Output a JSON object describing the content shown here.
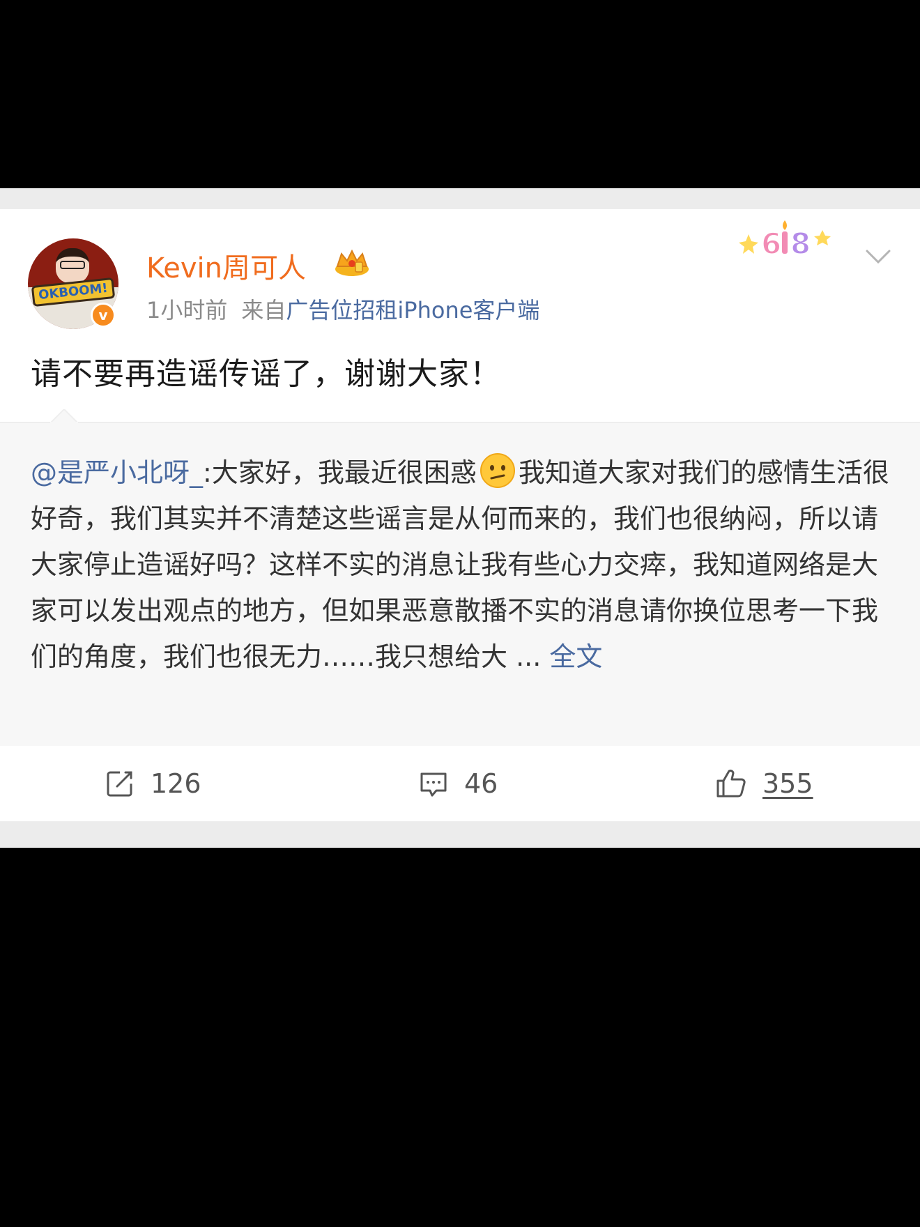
{
  "post": {
    "username": "Kevin周可人",
    "time": "1小时前",
    "source_prefix": "来自",
    "source": "广告位招租iPhone客户端",
    "verified_badge": "v",
    "text": "请不要再造谣传谣了，谢谢大家！"
  },
  "quoted": {
    "mention": "@是严小北呀_",
    "text_before_emoji": ":大家好，我最近很困惑",
    "text_after_emoji": "我知道大家对我们的感情生活很好奇，我们其实并不清楚这些谣言是从何而来的，我们也很纳闷，所以请大家停止造谣好吗？这样不实的消息让我有些心力交瘁，我知道网络是大家可以发出观点的地方，但如果恶意散播不实的消息请你换位思考一下我们的角度，我们也很无力……我只想给大 ...",
    "more_label": "全文",
    "emoji": "confused-face"
  },
  "avatar": {
    "comic_text": "OKBOOM!"
  },
  "actions": {
    "repost_count": "126",
    "comment_count": "46",
    "like_count": "355"
  },
  "icons": {
    "repost": "repost-icon",
    "comment": "comment-icon",
    "like": "thumbs-up-icon",
    "crown": "crown-icon",
    "more": "chevron-down-icon",
    "sticker": "618-sticker-icon"
  },
  "colors": {
    "username": "#f06c1e",
    "link": "#4a6aa0",
    "meta": "#8a8a8a",
    "quote_bg": "#f7f7f7"
  }
}
